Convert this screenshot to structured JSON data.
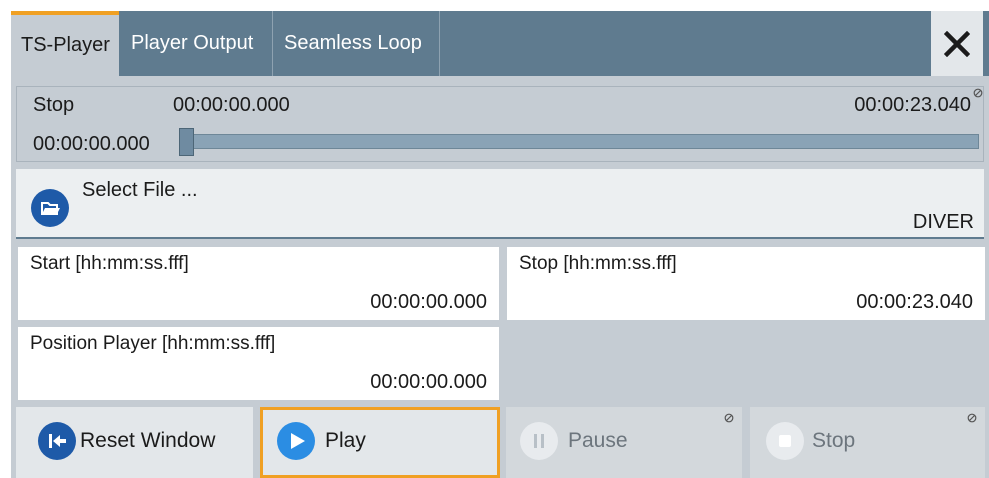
{
  "tabs": [
    {
      "label": "TS-Player",
      "active": true
    },
    {
      "label": "Player Output",
      "active": false
    },
    {
      "label": "Seamless Loop",
      "active": false
    }
  ],
  "close_icon": "close-icon",
  "status": {
    "state": "Stop",
    "current_time": "00:00:00.000",
    "total_time": "00:00:23.040",
    "position_time": "00:00:00.000",
    "slider_fraction": 0.0
  },
  "select_file": {
    "label": "Select File ...",
    "value": "DIVER",
    "icon": "folder-open-icon"
  },
  "fields": {
    "start": {
      "label": "Start [hh:mm:ss.fff]",
      "value": "00:00:00.000"
    },
    "stop": {
      "label": "Stop [hh:mm:ss.fff]",
      "value": "00:00:23.040"
    },
    "position": {
      "label": "Position Player [hh:mm:ss.fff]",
      "value": "00:00:00.000"
    }
  },
  "buttons": {
    "reset": {
      "label": "Reset Window",
      "icon": "reset-icon"
    },
    "play": {
      "label": "Play",
      "icon": "play-icon"
    },
    "pause": {
      "label": "Pause",
      "icon": "pause-icon"
    },
    "stop": {
      "label": "Stop",
      "icon": "stop-icon"
    }
  },
  "colors": {
    "accent": "#f0a023",
    "tabbar": "#5f7b8f",
    "icon_blue": "#1e5aa8",
    "play_blue": "#2b8de3"
  }
}
